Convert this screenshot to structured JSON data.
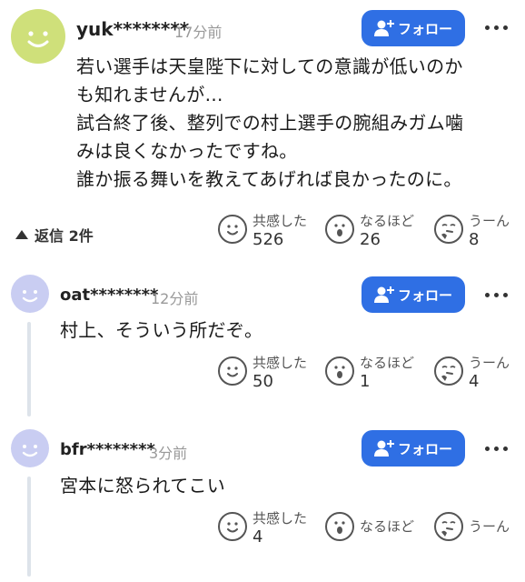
{
  "comments": [
    {
      "username": "yuk********",
      "time": "17分前",
      "follow_label": "フォロー",
      "lines": [
        "若い選手は天皇陛下に対しての意識が低いのか",
        "も知れませんが…",
        "試合終了後、整列での村上選手の腕組みガム噛",
        "みは良くなかったですね。",
        "誰か振る舞いを教えてあげれば良かったのに。"
      ],
      "reply_label": "返信 2件",
      "reactions": [
        {
          "label": "共感した",
          "count": "526",
          "icon": "smile-face-icon"
        },
        {
          "label": "なるほど",
          "count": "26",
          "icon": "surprised-face-icon"
        },
        {
          "label": "うーん",
          "count": "8",
          "icon": "thinking-face-icon"
        }
      ]
    },
    {
      "username": "oat********",
      "time": "12分前",
      "follow_label": "フォロー",
      "lines": [
        "村上、そういう所だぞ。"
      ],
      "reactions": [
        {
          "label": "共感した",
          "count": "50",
          "icon": "smile-face-icon"
        },
        {
          "label": "なるほど",
          "count": "1",
          "icon": "surprised-face-icon"
        },
        {
          "label": "うーん",
          "count": "4",
          "icon": "thinking-face-icon"
        }
      ]
    },
    {
      "username": "bfr********",
      "time": "3分前",
      "follow_label": "フォロー",
      "lines": [
        "宮本に怒られてこい"
      ],
      "reactions": [
        {
          "label": "共感した",
          "count": "4",
          "icon": "smile-face-icon"
        },
        {
          "label": "なるほど",
          "count": "",
          "icon": "surprised-face-icon"
        },
        {
          "label": "うーん",
          "count": "",
          "icon": "thinking-face-icon"
        }
      ]
    }
  ],
  "colors": {
    "avatar_main": "#cfe07a",
    "avatar_reply": "#c9cdf2",
    "follow_button": "#2f6fe4",
    "thread_line": "#dde3ea"
  }
}
